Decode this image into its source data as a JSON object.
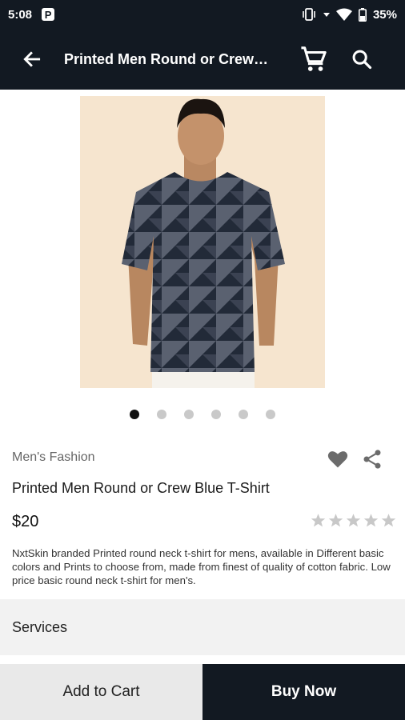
{
  "status_bar": {
    "time": "5:08",
    "app_badge": "P",
    "battery_percent": "35%"
  },
  "app_bar": {
    "title": "Printed Men Round or Crew Blue T-Shirt"
  },
  "carousel": {
    "count": 6,
    "active_index": 0
  },
  "product": {
    "category": "Men's Fashion",
    "name": "Printed Men Round or Crew Blue T-Shirt",
    "price": "$20",
    "rating": 0,
    "rating_max": 5,
    "description": "NxtSkin branded Printed round neck t-shirt for mens, available in Different basic colors and Prints to choose from, made from finest of quality of cotton fabric. Low price basic round neck t-shirt for men's."
  },
  "services": {
    "label": "Services"
  },
  "actions": {
    "add_to_cart": "Add to Cart",
    "buy_now": "Buy Now"
  },
  "colors": {
    "bar": "#121922",
    "hero_bg": "#f6e5cf",
    "star_empty": "#c8c8c8",
    "icon_grey": "#6b6b6b"
  }
}
